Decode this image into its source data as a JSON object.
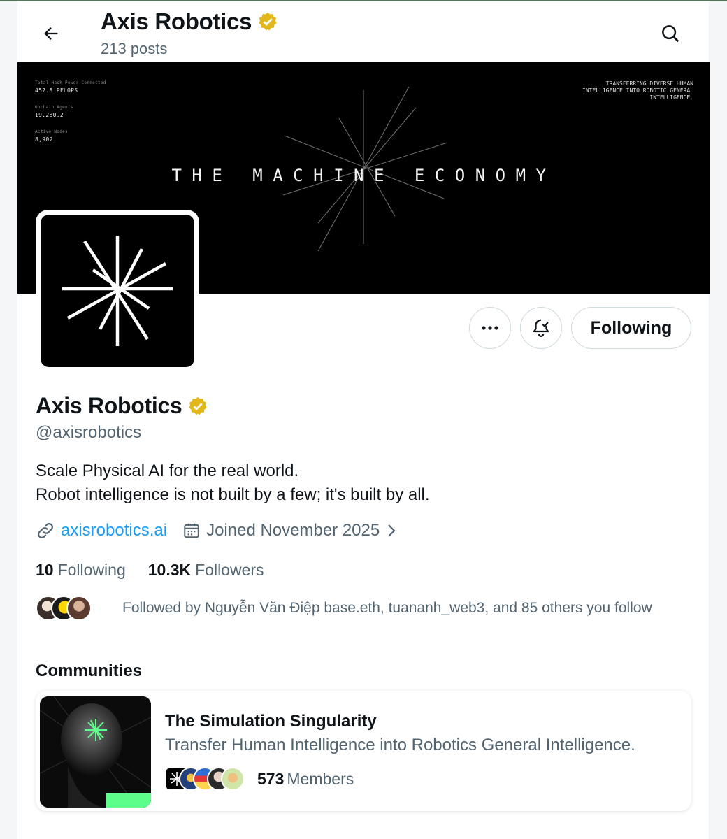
{
  "header": {
    "title": "Axis Robotics",
    "posts": "213 posts",
    "back_icon": "arrow-left-icon",
    "search_icon": "search-icon"
  },
  "banner": {
    "stats": [
      {
        "label": "Total Hash Power Connected",
        "value": "452.8 PFLOPS"
      },
      {
        "label": "Onchain Agents",
        "value": "19,280.2"
      },
      {
        "label": "Active Nodes",
        "value": "8,902"
      }
    ],
    "tagline": "TRANSFERRING DIVERSE HUMAN INTELLIGENCE INTO ROBOTIC GENERAL INTELLIGENCE.",
    "headline": "THE MACHINE ECONOMY"
  },
  "actions": {
    "more_icon": "more-icon",
    "notify_icon": "bell-check-icon",
    "follow_label": "Following"
  },
  "profile": {
    "name": "Axis Robotics",
    "verified_color": "#e2b719",
    "handle": "@axisrobotics",
    "bio_line1": "Scale Physical AI for the real world.",
    "bio_line2": "Robot intelligence is not built by a few; it's built by all.",
    "website": "axisrobotics.ai",
    "joined": "Joined November 2025",
    "following_count": "10",
    "following_label": "Following",
    "followers_count": "10.3K",
    "followers_label": "Followers",
    "followed_by": "Followed by Nguyễn Văn Điệp base.eth, tuananh_web3, and 85 others you follow"
  },
  "communities": {
    "title": "Communities",
    "items": [
      {
        "name": "The Simulation Singularity",
        "description": "Transfer Human Intelligence into Robotics General Intelligence.",
        "member_count": "573",
        "member_label": "Members"
      }
    ]
  },
  "colors": {
    "link": "#1d9bf0",
    "secondary_text": "#536471",
    "accent_green": "#4dff88"
  }
}
